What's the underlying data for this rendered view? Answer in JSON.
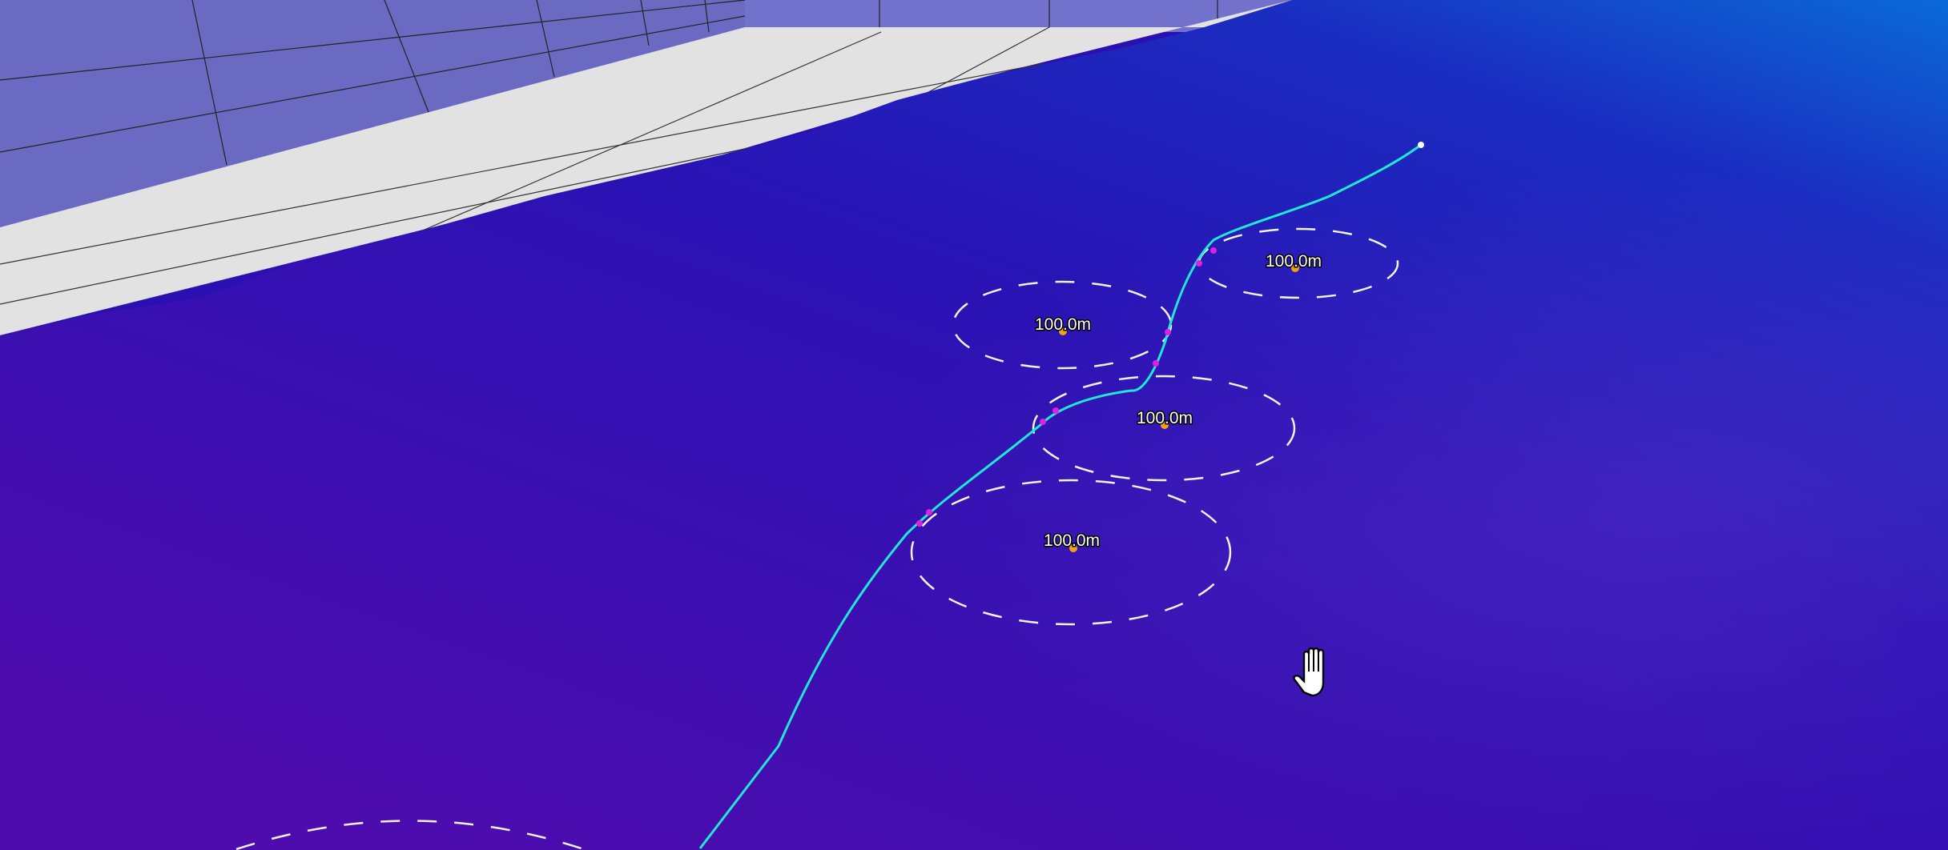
{
  "viewport": {
    "terrain_colors": {
      "far": "#0a5fd0",
      "mid": "#2a10b8",
      "near": "#5a0ab0"
    },
    "wall_color": "#6f6fc8",
    "floor_color": "#e4e4e4",
    "track_color": "#22e6d6",
    "waypoint_color": "#e020e0",
    "marker_color": "#f5a010"
  },
  "zones": [
    {
      "label": "100.0m"
    },
    {
      "label": "100.0m"
    },
    {
      "label": "100.0m"
    },
    {
      "label": "100.0m"
    }
  ],
  "cursor": {
    "icon": "hand-grab-icon"
  }
}
